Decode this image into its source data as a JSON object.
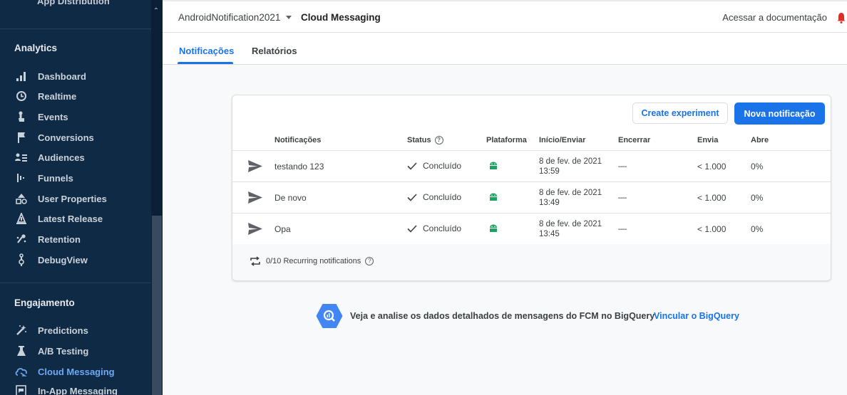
{
  "sidebar": {
    "top_cut_label": "App Distribution",
    "sections": [
      {
        "title": "Analytics",
        "items": [
          {
            "label": "Dashboard",
            "icon": "dashboard-icon"
          },
          {
            "label": "Realtime",
            "icon": "clock-icon"
          },
          {
            "label": "Events",
            "icon": "touch-icon"
          },
          {
            "label": "Conversions",
            "icon": "flag-icon"
          },
          {
            "label": "Audiences",
            "icon": "audience-icon"
          },
          {
            "label": "Funnels",
            "icon": "funnel-icon"
          },
          {
            "label": "User Properties",
            "icon": "user-properties-icon"
          },
          {
            "label": "Latest Release",
            "icon": "release-icon"
          },
          {
            "label": "Retention",
            "icon": "retention-icon"
          },
          {
            "label": "DebugView",
            "icon": "debug-icon"
          }
        ]
      },
      {
        "title": "Engajamento",
        "items": [
          {
            "label": "Predictions",
            "icon": "predictions-icon"
          },
          {
            "label": "A/B Testing",
            "icon": "flask-icon"
          },
          {
            "label": "Cloud Messaging",
            "icon": "cloud-messaging-icon",
            "active": true
          },
          {
            "label": "In-App Messaging",
            "icon": "in-app-messaging-icon"
          }
        ]
      }
    ]
  },
  "header": {
    "project": "AndroidNotification2021",
    "page": "Cloud Messaging",
    "docs_link": "Acessar a documentação"
  },
  "tabs": [
    {
      "label": "Notificações",
      "active": true
    },
    {
      "label": "Relatórios",
      "active": false
    }
  ],
  "card": {
    "create_experiment": "Create experiment",
    "new_notification": "Nova notificação",
    "columns": {
      "notifications": "Notificações",
      "status": "Status",
      "platform": "Plataforma",
      "start": "Início/Enviar",
      "end": "Encerrar",
      "sends": "Envia",
      "opens": "Abre"
    },
    "rows": [
      {
        "name": "testando 123",
        "status": "Concluído",
        "date": "8 de fev. de 2021",
        "time": "13:59",
        "end": "—",
        "sends": "< 1.000",
        "opens": "0%"
      },
      {
        "name": "De novo",
        "status": "Concluído",
        "date": "8 de fev. de 2021",
        "time": "13:49",
        "end": "—",
        "sends": "< 1.000",
        "opens": "0%"
      },
      {
        "name": "Opa",
        "status": "Concluído",
        "date": "8 de fev. de 2021",
        "time": "13:45",
        "end": "—",
        "sends": "< 1.000",
        "opens": "0%"
      }
    ],
    "recurring": "0/10 Recurring notifications"
  },
  "bigquery": {
    "text": "Veja e analise os dados detalhados de mensagens do FCM no BigQuery",
    "link": "Vincular o BigQuery"
  },
  "colors": {
    "sidebar_bg": "#0f2a45",
    "accent": "#1a73e8",
    "active_nav": "#6fa8f5",
    "android_green": "#1ea362"
  }
}
